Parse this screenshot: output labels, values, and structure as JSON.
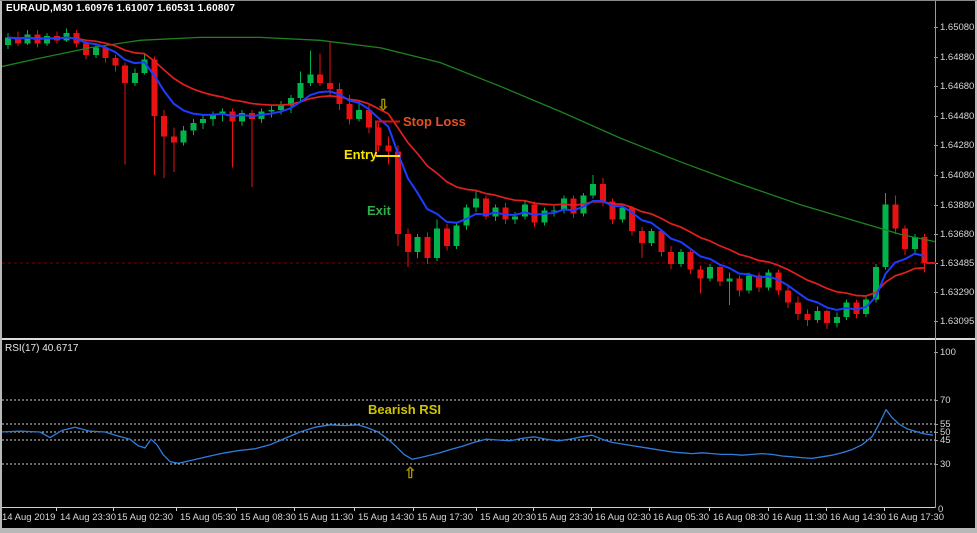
{
  "window": {
    "title": "EURAUD,M30  1.60976 1.61007 1.60531 1.60807"
  },
  "colors": {
    "background": "#000000",
    "bull_candle": "#00b44b",
    "bear_candle": "#e81212",
    "ma_fast_blue": "#1e3cff",
    "ma_slow_red": "#e02020",
    "ma_long_green": "#1e821e",
    "rsi_line": "#2f7edc",
    "rsi_level_line": "#cfcfcf",
    "axis_text": "#d6d6d6",
    "current_price_line": "#8b0000",
    "stop_loss": "#e85020",
    "entry": "#f5e600",
    "exit": "#2fae4c",
    "bearish_rsi": "#cfc400",
    "arrow": "#a39400"
  },
  "annotations": {
    "stop_loss": {
      "label": "Stop Loss",
      "price": 1.6444
    },
    "entry": {
      "label": "Entry",
      "price": 1.6421
    },
    "exit": {
      "label": "Exit"
    },
    "sell_arrow": {
      "glyph": "⇩"
    },
    "bearish_rsi": {
      "label": "Bearish RSI"
    },
    "buy_arrow": {
      "glyph": "⇧"
    }
  },
  "rsi_axis": {
    "ticks": [
      "100",
      "70",
      "55",
      "50",
      "45",
      "30"
    ],
    "zero_label": "0"
  },
  "chart_data": [
    {
      "type": "candlestick",
      "title": "EURAUD,M30",
      "symbol": "EURAUD",
      "timeframe": "M30",
      "ohlc_title_values": [
        "1.60976",
        "1.61007",
        "1.60531",
        "1.60807"
      ],
      "y_ticks": [
        "1.65080",
        "1.64880",
        "1.64680",
        "1.64480",
        "1.64280",
        "1.64080",
        "1.63880",
        "1.63680",
        "1.63485",
        "1.63290",
        "1.63095"
      ],
      "current_price": "1.63485",
      "ylim": [
        1.6296,
        1.6525
      ],
      "x_labels": [
        "14 Aug 2019",
        "14 Aug 23:30",
        "15 Aug 02:30",
        "15 Aug 05:30",
        "15 Aug 08:30",
        "15 Aug 11:30",
        "15 Aug 14:30",
        "15 Aug 17:30",
        "15 Aug 20:30",
        "15 Aug 23:30",
        "16 Aug 02:30",
        "16 Aug 05:30",
        "16 Aug 08:30",
        "16 Aug 11:30",
        "16 Aug 14:30",
        "16 Aug 17:30"
      ],
      "annotations": [
        "Stop Loss",
        "Entry",
        "Exit"
      ],
      "ohlc": [
        [
          1.6496,
          1.6504,
          1.6493,
          1.6501
        ],
        [
          1.6501,
          1.6505,
          1.6495,
          1.6497
        ],
        [
          1.6497,
          1.6506,
          1.6496,
          1.6503
        ],
        [
          1.6503,
          1.6506,
          1.6494,
          1.6497
        ],
        [
          1.6497,
          1.6504,
          1.6495,
          1.6502
        ],
        [
          1.6502,
          1.6505,
          1.6497,
          1.6499
        ],
        [
          1.6499,
          1.6507,
          1.6498,
          1.6504
        ],
        [
          1.6504,
          1.6506,
          1.6494,
          1.6497
        ],
        [
          1.6497,
          1.6499,
          1.6486,
          1.6489
        ],
        [
          1.6489,
          1.6497,
          1.6487,
          1.6494
        ],
        [
          1.6494,
          1.6495,
          1.6484,
          1.6487
        ],
        [
          1.6487,
          1.6489,
          1.6478,
          1.6482
        ],
        [
          1.6482,
          1.6484,
          1.6415,
          1.647
        ],
        [
          1.647,
          1.648,
          1.6468,
          1.6477
        ],
        [
          1.6477,
          1.649,
          1.6476,
          1.6486
        ],
        [
          1.6486,
          1.6488,
          1.6408,
          1.6448
        ],
        [
          1.6448,
          1.6452,
          1.6406,
          1.6434
        ],
        [
          1.6434,
          1.644,
          1.641,
          1.643
        ],
        [
          1.643,
          1.6441,
          1.6428,
          1.6438
        ],
        [
          1.6438,
          1.6446,
          1.6435,
          1.6443
        ],
        [
          1.6443,
          1.6449,
          1.6439,
          1.6446
        ],
        [
          1.6446,
          1.6451,
          1.6441,
          1.6449
        ],
        [
          1.6449,
          1.6453,
          1.6444,
          1.6451
        ],
        [
          1.6451,
          1.6453,
          1.6413,
          1.6444
        ],
        [
          1.6444,
          1.6452,
          1.6441,
          1.645
        ],
        [
          1.645,
          1.6452,
          1.64,
          1.6446
        ],
        [
          1.6446,
          1.6453,
          1.6443,
          1.6451
        ],
        [
          1.6451,
          1.6455,
          1.6447,
          1.6452
        ],
        [
          1.6452,
          1.6458,
          1.6449,
          1.6455
        ],
        [
          1.6455,
          1.6462,
          1.645,
          1.646
        ],
        [
          1.646,
          1.6478,
          1.6458,
          1.647
        ],
        [
          1.647,
          1.6492,
          1.6468,
          1.6476
        ],
        [
          1.6476,
          1.649,
          1.6468,
          1.647
        ],
        [
          1.647,
          1.6498,
          1.6462,
          1.6466
        ],
        [
          1.6466,
          1.647,
          1.6452,
          1.6456
        ],
        [
          1.6456,
          1.6462,
          1.6442,
          1.6446
        ],
        [
          1.6446,
          1.6458,
          1.6444,
          1.6452
        ],
        [
          1.6452,
          1.6456,
          1.6436,
          1.644
        ],
        [
          1.644,
          1.6443,
          1.6424,
          1.6428
        ],
        [
          1.6428,
          1.6434,
          1.6415,
          1.6424
        ],
        [
          1.6424,
          1.6428,
          1.636,
          1.6368
        ],
        [
          1.6368,
          1.6372,
          1.6346,
          1.6356
        ],
        [
          1.6356,
          1.6368,
          1.6352,
          1.6366
        ],
        [
          1.6366,
          1.6369,
          1.6348,
          1.6352
        ],
        [
          1.6352,
          1.6378,
          1.635,
          1.6372
        ],
        [
          1.6372,
          1.6375,
          1.6357,
          1.636
        ],
        [
          1.636,
          1.6376,
          1.6358,
          1.6374
        ],
        [
          1.6374,
          1.6388,
          1.6371,
          1.6386
        ],
        [
          1.6386,
          1.6398,
          1.6383,
          1.6392
        ],
        [
          1.6392,
          1.6394,
          1.6378,
          1.638
        ],
        [
          1.638,
          1.6388,
          1.6377,
          1.6386
        ],
        [
          1.6386,
          1.6389,
          1.6375,
          1.6378
        ],
        [
          1.6378,
          1.6383,
          1.6375,
          1.638
        ],
        [
          1.638,
          1.639,
          1.6378,
          1.6388
        ],
        [
          1.6388,
          1.639,
          1.6373,
          1.6376
        ],
        [
          1.6376,
          1.6386,
          1.6374,
          1.6384
        ],
        [
          1.6384,
          1.6387,
          1.638,
          1.6384
        ],
        [
          1.6384,
          1.6394,
          1.6382,
          1.6392
        ],
        [
          1.6392,
          1.6394,
          1.6379,
          1.6382
        ],
        [
          1.6382,
          1.6396,
          1.638,
          1.6394
        ],
        [
          1.6394,
          1.6408,
          1.6392,
          1.6402
        ],
        [
          1.6402,
          1.6406,
          1.6387,
          1.639
        ],
        [
          1.639,
          1.6392,
          1.6375,
          1.6378
        ],
        [
          1.6378,
          1.6388,
          1.6376,
          1.6386
        ],
        [
          1.6386,
          1.6387,
          1.6367,
          1.637
        ],
        [
          1.637,
          1.6373,
          1.6352,
          1.6362
        ],
        [
          1.6362,
          1.6372,
          1.636,
          1.637
        ],
        [
          1.637,
          1.6371,
          1.6353,
          1.6356
        ],
        [
          1.6356,
          1.636,
          1.6344,
          1.6348
        ],
        [
          1.6348,
          1.6358,
          1.6346,
          1.6356
        ],
        [
          1.6356,
          1.6357,
          1.6341,
          1.6344
        ],
        [
          1.6344,
          1.6347,
          1.6328,
          1.6338
        ],
        [
          1.6338,
          1.6348,
          1.6336,
          1.6346
        ],
        [
          1.6346,
          1.6348,
          1.6333,
          1.6336
        ],
        [
          1.6336,
          1.6342,
          1.632,
          1.6338
        ],
        [
          1.6338,
          1.634,
          1.6326,
          1.633
        ],
        [
          1.633,
          1.6342,
          1.6328,
          1.634
        ],
        [
          1.634,
          1.6342,
          1.6329,
          1.6332
        ],
        [
          1.6332,
          1.6344,
          1.633,
          1.6342
        ],
        [
          1.6342,
          1.6344,
          1.6327,
          1.633
        ],
        [
          1.633,
          1.6333,
          1.6318,
          1.6322
        ],
        [
          1.6322,
          1.6326,
          1.631,
          1.6314
        ],
        [
          1.6314,
          1.6317,
          1.6306,
          1.631
        ],
        [
          1.631,
          1.6319,
          1.6308,
          1.6316
        ],
        [
          1.6316,
          1.6317,
          1.6304,
          1.6308
        ],
        [
          1.6308,
          1.6315,
          1.6305,
          1.6312
        ],
        [
          1.6312,
          1.6324,
          1.631,
          1.6322
        ],
        [
          1.6322,
          1.6324,
          1.6311,
          1.6314
        ],
        [
          1.6314,
          1.6326,
          1.6312,
          1.6324
        ],
        [
          1.6324,
          1.6348,
          1.6322,
          1.6346
        ],
        [
          1.6346,
          1.6396,
          1.6344,
          1.6388
        ],
        [
          1.6388,
          1.6394,
          1.6368,
          1.6372
        ],
        [
          1.6372,
          1.6374,
          1.6354,
          1.6358
        ],
        [
          1.6358,
          1.6368,
          1.6355,
          1.6366
        ],
        [
          1.6366,
          1.6368,
          1.6342,
          1.63485
        ]
      ],
      "series": [
        {
          "name": "fast MA (blue)",
          "derived": "ema",
          "period": 7,
          "color": "#1e3cff"
        },
        {
          "name": "slow MA (red)",
          "derived": "ema",
          "period": 16,
          "color": "#e02020"
        },
        {
          "name": "long MA (green)",
          "color": "#1e821e",
          "points": [
            [
              0,
              1.6481
            ],
            [
              40,
              1.6487
            ],
            [
              90,
              1.6494
            ],
            [
              140,
              1.6499
            ],
            [
              200,
              1.6501
            ],
            [
              260,
              1.6501
            ],
            [
              320,
              1.6499
            ],
            [
              380,
              1.6494
            ],
            [
              440,
              1.6484
            ],
            [
              500,
              1.6468
            ],
            [
              560,
              1.6451
            ],
            [
              620,
              1.6433
            ],
            [
              680,
              1.6417
            ],
            [
              740,
              1.6402
            ],
            [
              800,
              1.6388
            ],
            [
              850,
              1.6378
            ],
            [
              900,
              1.6368
            ],
            [
              935,
              1.6363
            ]
          ]
        }
      ]
    },
    {
      "type": "line",
      "name": "RSI",
      "period": 17,
      "label": "RSI(17) 40.6717",
      "current_value": "40.6717",
      "ylim": [
        0,
        100
      ],
      "levels": [
        70,
        55,
        50,
        45,
        30
      ],
      "annotations": [
        "Bearish RSI"
      ],
      "points": [
        [
          0,
          50
        ],
        [
          20,
          50.5
        ],
        [
          40,
          50
        ],
        [
          50,
          46.5
        ],
        [
          62,
          51
        ],
        [
          75,
          53
        ],
        [
          90,
          50.5
        ],
        [
          105,
          50
        ],
        [
          118,
          47.5
        ],
        [
          130,
          45.5
        ],
        [
          138,
          41.5
        ],
        [
          145,
          40
        ],
        [
          151,
          45.5
        ],
        [
          157,
          42
        ],
        [
          163,
          36
        ],
        [
          170,
          31.5
        ],
        [
          178,
          30.5
        ],
        [
          186,
          31.5
        ],
        [
          196,
          33
        ],
        [
          210,
          35
        ],
        [
          225,
          37
        ],
        [
          240,
          38.5
        ],
        [
          255,
          39.5
        ],
        [
          270,
          42
        ],
        [
          285,
          46
        ],
        [
          300,
          50
        ],
        [
          315,
          53
        ],
        [
          330,
          54.5
        ],
        [
          345,
          54
        ],
        [
          358,
          54.5
        ],
        [
          368,
          52.5
        ],
        [
          378,
          50
        ],
        [
          388,
          45.5
        ],
        [
          396,
          41
        ],
        [
          404,
          36
        ],
        [
          412,
          33
        ],
        [
          420,
          34
        ],
        [
          430,
          35.5
        ],
        [
          440,
          37
        ],
        [
          450,
          39
        ],
        [
          462,
          41
        ],
        [
          474,
          43.5
        ],
        [
          486,
          45.5
        ],
        [
          498,
          45
        ],
        [
          510,
          44.5
        ],
        [
          522,
          46
        ],
        [
          534,
          47
        ],
        [
          546,
          45.5
        ],
        [
          558,
          44.5
        ],
        [
          570,
          45.5
        ],
        [
          582,
          47
        ],
        [
          592,
          48
        ],
        [
          602,
          45.5
        ],
        [
          612,
          43.5
        ],
        [
          622,
          42.5
        ],
        [
          632,
          41.5
        ],
        [
          642,
          40.5
        ],
        [
          652,
          39.5
        ],
        [
          662,
          38.5
        ],
        [
          672,
          37.5
        ],
        [
          682,
          37
        ],
        [
          692,
          36.5
        ],
        [
          702,
          37
        ],
        [
          712,
          36.5
        ],
        [
          722,
          36
        ],
        [
          732,
          36
        ],
        [
          742,
          35.5
        ],
        [
          752,
          36
        ],
        [
          762,
          36.5
        ],
        [
          772,
          36
        ],
        [
          782,
          35
        ],
        [
          792,
          34.5
        ],
        [
          802,
          34
        ],
        [
          812,
          33.5
        ],
        [
          822,
          34.5
        ],
        [
          832,
          35.5
        ],
        [
          842,
          37
        ],
        [
          852,
          39
        ],
        [
          862,
          42
        ],
        [
          872,
          47
        ],
        [
          880,
          56
        ],
        [
          886,
          64
        ],
        [
          892,
          59
        ],
        [
          899,
          55
        ],
        [
          907,
          52
        ],
        [
          915,
          50.5
        ],
        [
          923,
          49
        ],
        [
          933,
          48
        ]
      ]
    }
  ]
}
